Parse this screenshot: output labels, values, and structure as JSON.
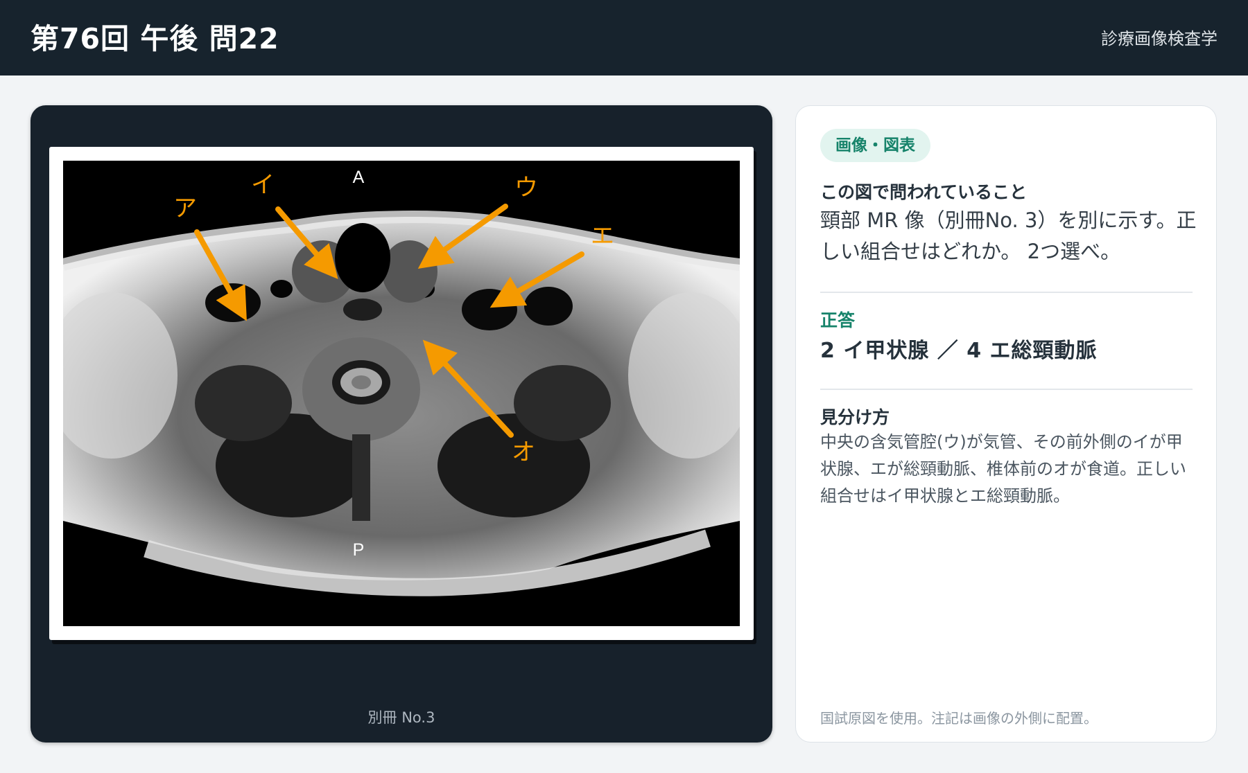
{
  "header": {
    "title": "第76回 午後 問22",
    "subject": "診療画像検査学"
  },
  "figure": {
    "caption": "別冊 No.3",
    "orientation_top": "A",
    "orientation_bottom": "P",
    "arrow_color": "#f59a00",
    "labels": [
      "ア",
      "イ",
      "ウ",
      "エ",
      "オ"
    ]
  },
  "panel": {
    "tag": "画像・図表",
    "question_heading": "この図で問われていること",
    "question_text": "頸部 MR 像（別冊No. 3）を別に示す。正しい組合せはどれか。 2つ選べ。",
    "answer_heading": "正答",
    "answer_text": "2 イ甲状腺 ／ 4 エ総頸動脈",
    "explain_heading": "見分け方",
    "explain_text": "中央の含気管腔(ウ)が気管、その前外側のイが甲状腺、エが総頸動脈、椎体前のオが食道。正しい組合せはイ甲状腺とエ総頸動脈。",
    "footnote": "国試原図を使用。注記は画像の外側に配置。"
  },
  "colors": {
    "header_bg": "#17232d",
    "viewer_bg": "#17212b",
    "accent_green": "#16836a",
    "tag_bg": "#e2f4ef"
  }
}
